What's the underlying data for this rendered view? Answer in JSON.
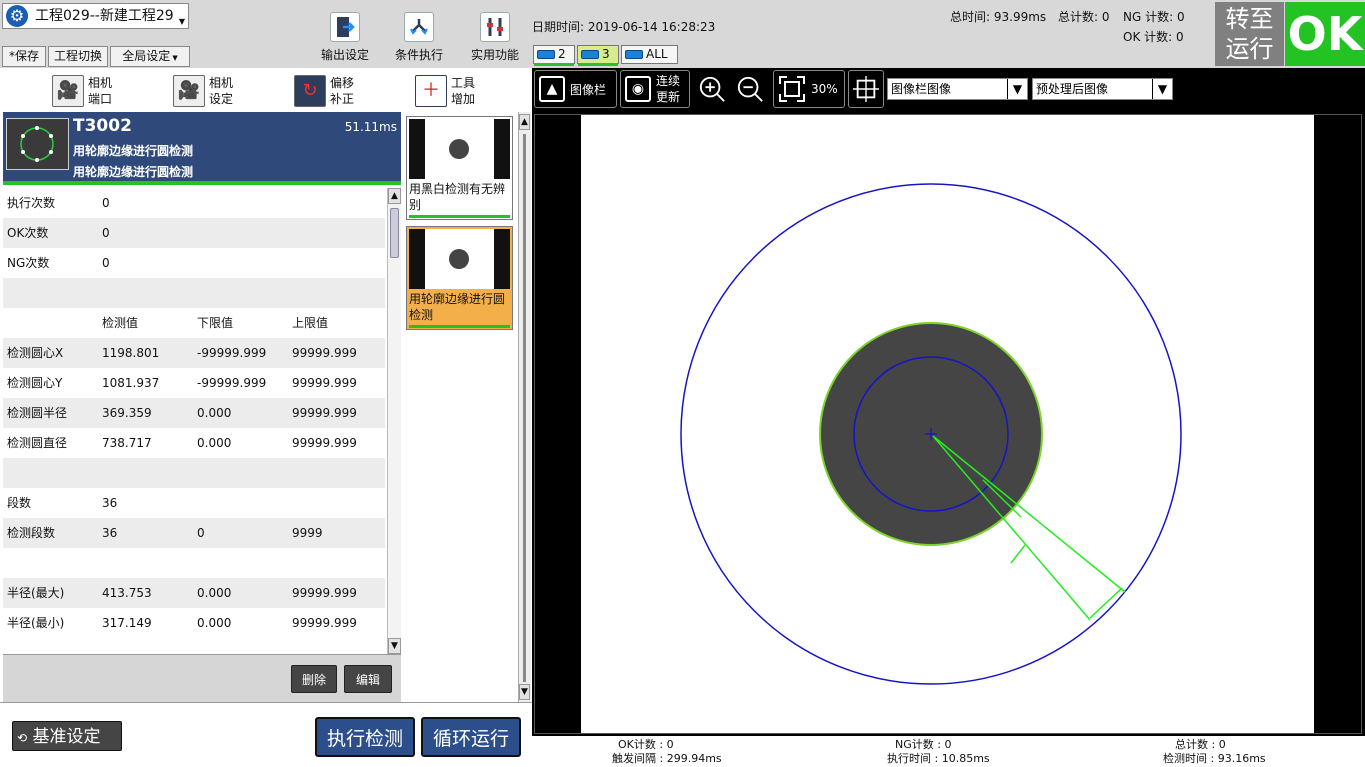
{
  "project": {
    "name": "工程029--新建工程29"
  },
  "top_menu": {
    "save": "*保存",
    "switch": "工程切换",
    "global": "全局设定"
  },
  "toolbar": {
    "output": "输出设定",
    "condition": "条件执行",
    "utility": "实用功能"
  },
  "datetime": "日期时间: 2019-06-14 16:28:23",
  "stats": {
    "total_time": "总时间:  93.99ms",
    "total_count": "总计数: 0",
    "ng_count": "NG 计数: 0",
    "ok_count": "OK 计数: 0"
  },
  "camera_tabs": [
    {
      "label": "2"
    },
    {
      "label": "3"
    },
    {
      "label": "ALL"
    }
  ],
  "run_mode": {
    "line1": "转至",
    "line2": "运行"
  },
  "result": "OK",
  "left_tools": [
    {
      "line1": "相机",
      "line2": "端口",
      "icon": "camera-port-icon"
    },
    {
      "line1": "相机",
      "line2": "设定",
      "icon": "camera-settings-icon"
    },
    {
      "line1": "偏移",
      "line2": "补正",
      "icon": "offset-icon"
    },
    {
      "line1": "工具",
      "line2": "增加",
      "icon": "tool-add-icon"
    }
  ],
  "tool_header": {
    "id": "T3002",
    "time": "51.11ms",
    "name1": "用轮廓边缘进行圆检测",
    "name2": "用轮廓边缘进行圆检测"
  },
  "table_rows": [
    {
      "c0": "执行次数",
      "c1": "0",
      "c2": "",
      "c3": ""
    },
    {
      "c0": "OK次数",
      "c1": "0",
      "c2": "",
      "c3": ""
    },
    {
      "c0": "NG次数",
      "c1": "0",
      "c2": "",
      "c3": ""
    },
    {
      "c0": "",
      "c1": "",
      "c2": "",
      "c3": ""
    },
    {
      "c0": "",
      "c1": "检测值",
      "c2": "下限值",
      "c3": "上限值"
    },
    {
      "c0": "检测圆心X",
      "c1": "1198.801",
      "c2": "-99999.999",
      "c3": "99999.999"
    },
    {
      "c0": "检测圆心Y",
      "c1": "1081.937",
      "c2": "-99999.999",
      "c3": "99999.999"
    },
    {
      "c0": "检测圆半径",
      "c1": "369.359",
      "c2": "0.000",
      "c3": "99999.999"
    },
    {
      "c0": "检测圆直径",
      "c1": "738.717",
      "c2": "0.000",
      "c3": "99999.999"
    },
    {
      "c0": "",
      "c1": "",
      "c2": "",
      "c3": ""
    },
    {
      "c0": "段数",
      "c1": "36",
      "c2": "",
      "c3": ""
    },
    {
      "c0": "检测段数",
      "c1": "36",
      "c2": "0",
      "c3": "9999"
    },
    {
      "c0": "",
      "c1": "",
      "c2": "",
      "c3": ""
    },
    {
      "c0": "半径(最大)",
      "c1": "413.753",
      "c2": "0.000",
      "c3": "99999.999"
    },
    {
      "c0": "半径(最小)",
      "c1": "317.149",
      "c2": "0.000",
      "c3": "99999.999"
    }
  ],
  "buttons": {
    "delete": "删除",
    "edit": "编辑",
    "baseline": "基准设定",
    "execute": "执行检测",
    "loop": "循环运行"
  },
  "flow": [
    {
      "caption": "用黑白检测有无辨别"
    },
    {
      "caption": "用轮廓边缘进行圆检测"
    }
  ],
  "image_toolbar": {
    "image_bar": "图像栏",
    "continuous1": "连续",
    "continuous2": "更新",
    "zoom": "30%",
    "select1": "图像栏图像",
    "select2": "预处理后图像"
  },
  "bottom_stats": {
    "ok": "OK计数 : 0",
    "trigger": "触发间隔 : 299.94ms",
    "ng": "NG计数 : 0",
    "exec": "执行时间 : 10.85ms",
    "total": "总计数 : 0",
    "detect": "检测时间 : 93.16ms"
  },
  "colors": {
    "header": "#2f4a7a",
    "ok": "#22c322",
    "selected": "#f3b04a",
    "button": "#2c4f8c"
  }
}
